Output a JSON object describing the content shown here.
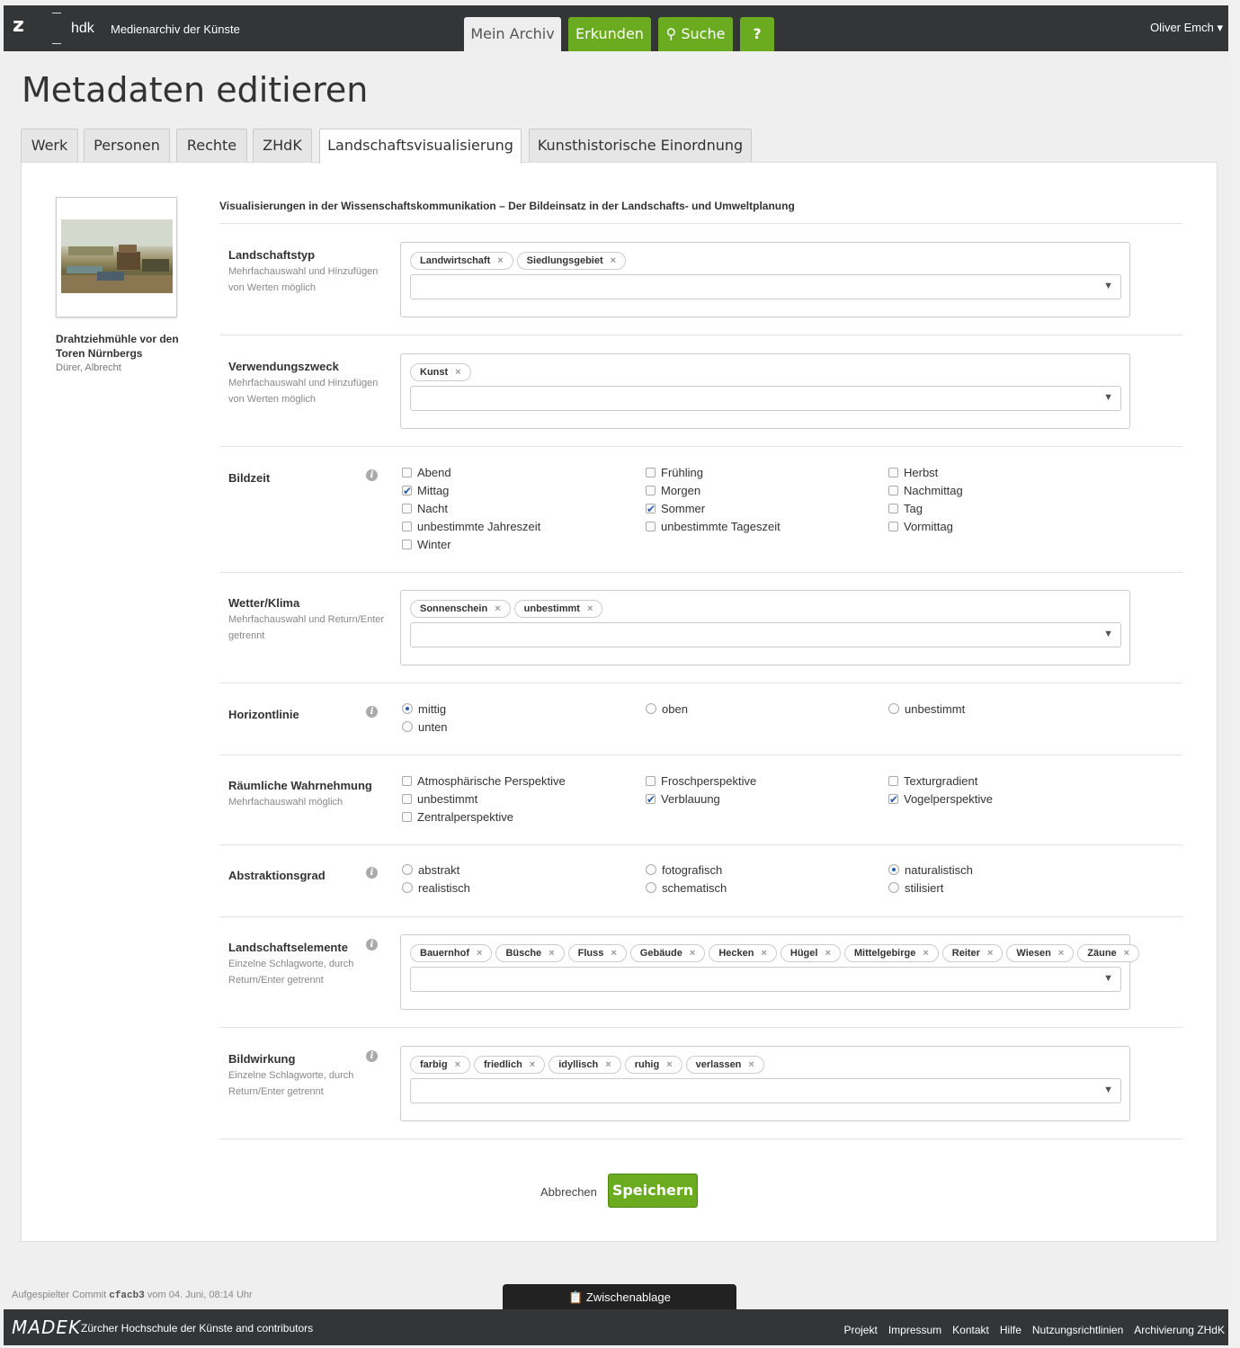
{
  "topbar": {
    "logo": "z",
    "hdk": "hdk",
    "brand": "Medienarchiv der Künste",
    "nav": {
      "archiv": "Mein Archiv",
      "erkunden": "Erkunden",
      "suche": "Suche",
      "help": "?"
    },
    "user": "Oliver Emch ▾"
  },
  "page_title": "Metadaten editieren",
  "tabs": [
    "Werk",
    "Personen",
    "Rechte",
    "ZHdK",
    "Landschaftsvisualisierung",
    "Kunsthistorische Einordnung"
  ],
  "media": {
    "title": "Drahtziehmühle vor den Toren Nürnbergs",
    "author": "Dürer, Albrecht"
  },
  "context_title": "Visualisierungen in der Wissenschaftskommunikation – Der Bildeinsatz in der Landschafts- und Umweltplanung",
  "fields": {
    "landschaftstyp": {
      "label": "Landschaftstyp",
      "hint": "Mehrfachauswahl und Hinzufügen von Werten möglich",
      "chips": [
        "Landwirtschaft",
        "Siedlungsgebiet"
      ]
    },
    "verwendungszweck": {
      "label": "Verwendungszweck",
      "hint": "Mehrfachauswahl und Hinzufügen von Werten möglich",
      "chips": [
        "Kunst"
      ]
    },
    "bildzeit": {
      "label": "Bildzeit",
      "options": [
        "Abend",
        "Frühling",
        "Herbst",
        "Mittag",
        "Morgen",
        "Nachmittag",
        "Nacht",
        "Sommer",
        "Tag",
        "unbestimmte Jahreszeit",
        "unbestimmte Tageszeit",
        "Vormittag",
        "Winter"
      ],
      "checked": [
        "Mittag",
        "Sommer"
      ]
    },
    "wetter": {
      "label": "Wetter/Klima",
      "hint": "Mehrfachauswahl und Return/Enter getrennt",
      "chips": [
        "Sonnenschein",
        "unbestimmt"
      ]
    },
    "horizontlinie": {
      "label": "Horizontlinie",
      "options": [
        "mittig",
        "oben",
        "unbestimmt",
        "unten"
      ],
      "selected": "mittig"
    },
    "raeumlich": {
      "label": "Räumliche Wahrnehmung",
      "hint": "Mehrfachauswahl möglich",
      "options": [
        "Atmosphärische Perspektive",
        "Froschperspektive",
        "Texturgradient",
        "unbestimmt",
        "Verblauung",
        "Vogelperspektive",
        "Zentralperspektive"
      ],
      "checked": [
        "Verblauung",
        "Vogelperspektive"
      ]
    },
    "abstraktion": {
      "label": "Abstraktionsgrad",
      "options": [
        "abstrakt",
        "fotografisch",
        "naturalistisch",
        "realistisch",
        "schematisch",
        "stilisiert"
      ],
      "selected": "naturalistisch"
    },
    "elemente": {
      "label": "Landschaftselemente",
      "hint": "Einzelne Schlagworte, durch Return/Enter getrennt",
      "chips": [
        "Bauernhof",
        "Büsche",
        "Fluss",
        "Gebäude",
        "Hecken",
        "Hügel",
        "Mittelgebirge",
        "Reiter",
        "Wiesen",
        "Zäune"
      ]
    },
    "bildwirkung": {
      "label": "Bildwirkung",
      "hint": "Einzelne Schlagworte, durch Return/Enter getrennt",
      "chips": [
        "farbig",
        "friedlich",
        "idyllisch",
        "ruhig",
        "verlassen"
      ]
    }
  },
  "actions": {
    "cancel": "Abbrechen",
    "save": "Speichern"
  },
  "footer": {
    "commit_prefix": "Aufgespielter Commit",
    "commit_hash": "cfacb3",
    "commit_suffix": "vom 04. Juni, 08:14 Uhr",
    "clipboard": "Zwischenablage",
    "madek": "MADEK",
    "contrib": "Zürcher Hochschule der Künste and contributors",
    "links": [
      "Projekt",
      "Impressum",
      "Kontakt",
      "Hilfe",
      "Nutzungsrichtlinien",
      "Archivierung ZHdK"
    ]
  },
  "colors": {
    "accent_green": "#6bab1f",
    "topbar": "#333536",
    "check_blue": "#2a5fb0"
  }
}
